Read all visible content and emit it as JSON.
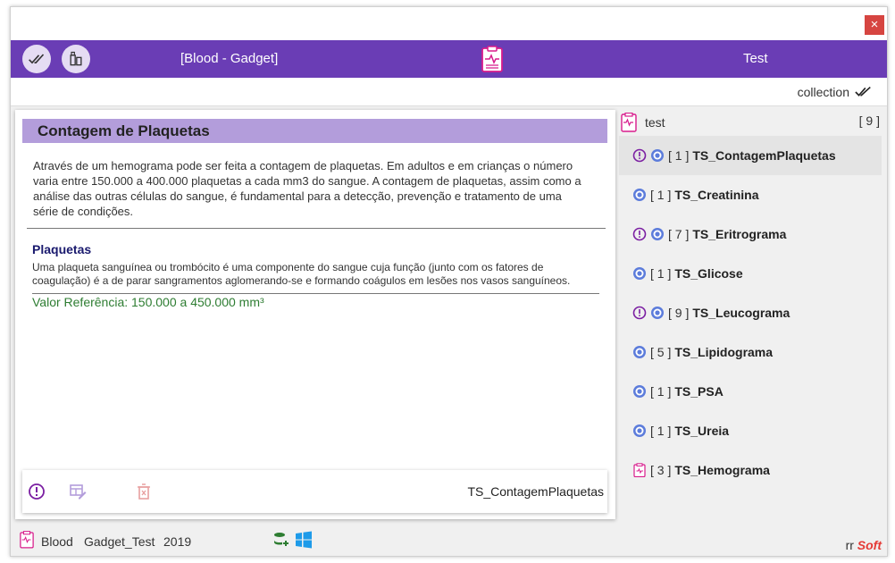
{
  "window": {
    "close_glyph": "×"
  },
  "appbar": {
    "app_title": "[Blood - Gadget]",
    "user_label": "Test",
    "accent": "#6a3db5"
  },
  "subbar": {
    "collection_label": "collection"
  },
  "detail": {
    "title": "Contagem de Plaquetas",
    "intro": "Através de um hemograma pode ser feita a contagem de plaquetas. Em adultos e em crianças o número varia entre 150.000 a 400.000 plaquetas a cada mm3 do sangue. A contagem de plaquetas, assim como a análise das outras células do sangue, é fundamental para a detecção, prevenção e tratamento de uma série de condições.",
    "section_title": "Plaquetas",
    "section_body": "Uma plaqueta sanguínea ou trombócito é uma componente do sangue cuja função (junto com os fatores de coagulação) é a de parar sangramentos aglomerando-se e formando coágulos em lesões nos vasos sanguíneos.",
    "reference_value": "Valor Referência: 150.000 a 450.000 mm³",
    "footer_label": "TS_ContagemPlaquetas"
  },
  "test_list": {
    "name": "test",
    "count": "[ 9 ]",
    "items": [
      {
        "warn": true,
        "bracket": "[ 1 ]",
        "name": "TS_ContagemPlaquetas",
        "icon": "target-icon",
        "selected": true
      },
      {
        "warn": false,
        "bracket": "[ 1 ]",
        "name": "TS_Creatinina",
        "icon": "target-icon"
      },
      {
        "warn": true,
        "bracket": "[ 7 ]",
        "name": "TS_Eritrograma",
        "icon": "target-icon"
      },
      {
        "warn": false,
        "bracket": "[ 1 ]",
        "name": "TS_Glicose",
        "icon": "target-icon"
      },
      {
        "warn": true,
        "bracket": "[ 9 ]",
        "name": "TS_Leucograma",
        "icon": "target-icon"
      },
      {
        "warn": false,
        "bracket": "[ 5 ]",
        "name": "TS_Lipidograma",
        "icon": "target-icon"
      },
      {
        "warn": false,
        "bracket": "[ 1 ]",
        "name": "TS_PSA",
        "icon": "target-icon"
      },
      {
        "warn": false,
        "bracket": "[ 1 ]",
        "name": "TS_Ureia",
        "icon": "target-icon"
      },
      {
        "warn": false,
        "bracket": "[ 3 ]",
        "name": "TS_Hemograma",
        "icon": "clipboard-icon"
      }
    ]
  },
  "footer": {
    "blood": "Blood",
    "gadget": "Gadget_Test",
    "year": "2019",
    "brand_prefix": "rr",
    "brand_name": "Soft"
  }
}
